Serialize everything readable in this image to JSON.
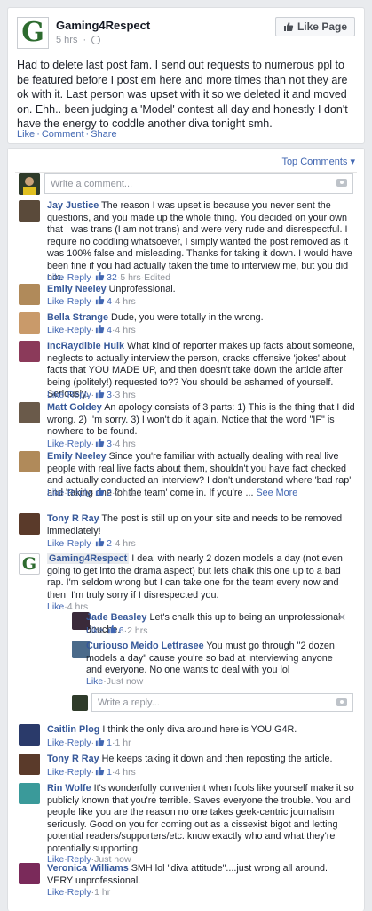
{
  "post": {
    "page_name": "Gaming4Respect",
    "logo_letter": "G",
    "time": "5 hrs",
    "like_page_label": "Like Page",
    "text": "Had to delete last post fam. I send out requests to numerous ppl to be featured before I post em here and more times than not they are ok with it. Last person was upset with it so we deleted it and moved on. Ehh.. been judging a 'Model' contest all day and honestly I don't have the energy to coddle another diva tonight smh.",
    "actions": [
      "Like",
      "Comment",
      "Share"
    ]
  },
  "comments_section": {
    "sort_label": "Top Comments ▾",
    "write_placeholder": "Write a comment...",
    "reply_placeholder": "Write a reply...",
    "comments": [
      {
        "name": "Jay Justice",
        "text": "The reason I was upset is because you never sent the questions, and you made up the whole thing. You decided on your own that I was trans (I am not trans) and were very rude and disrespectful. I require no coddling whatsoever, I simply wanted the post removed as it was 100% false and misleading. Thanks for taking it down. I would have been fine if you had actually taken the time to interview me, but you did not.",
        "likes": "32",
        "time": "5 hrs",
        "extra": "Edited",
        "avatar_color": "#5a4a3a"
      },
      {
        "name": "Emily Neeley",
        "text": "Unprofessional.",
        "likes": "4",
        "time": "4 hrs",
        "avatar_color": "#b08a5a"
      },
      {
        "name": "Bella Strange",
        "text": "Dude, you were totally in the wrong.",
        "likes": "4",
        "time": "4 hrs",
        "avatar_color": "#c99a6a"
      },
      {
        "name": "IncRaydible Hulk",
        "text": "What kind of reporter makes up facts about someone, neglects to actually interview the person, cracks offensive 'jokes' about facts that YOU MADE UP, and then doesn't take down the article after being (politely!) requested to?? You should be ashamed of yourself. Seriously.",
        "likes": "3",
        "time": "3 hrs",
        "avatar_color": "#8b3a5a"
      },
      {
        "name": "Matt Goldey",
        "text": "An apology consists of 3 parts: 1) This is the thing that I did wrong. 2) I'm sorry. 3) I won't do it again. Notice that the word \"IF\" is nowhere to be found.",
        "likes": "3",
        "time": "4 hrs",
        "avatar_color": "#6a5a4a"
      },
      {
        "name": "Emily Neeley",
        "text": "Since you're familiar with actually dealing with real live people with real live facts about them, shouldn't you have fact checked and actually conducted an interview? I don't understand where 'bad rap' and 'taking one for the team' come in. If you're ...",
        "see_more": "See More",
        "likes": "2",
        "time": "2 hrs",
        "avatar_color": "#b08a5a"
      },
      {
        "name": "Tony R Ray",
        "text": "The post is still up on your site and needs to be removed immediately!",
        "likes": "2",
        "time": "4 hrs",
        "avatar_color": "#5a3a2a"
      },
      {
        "name": "Gaming4Respect",
        "text": "I deal with nearly 2 dozen models a day (not even going to get into the drama aspect) but lets chalk this one up to a bad rap. I'm seldom wrong but I can take one for the team every now and then. I'm truly sorry if I disrespected you.",
        "time": "4 hrs",
        "avatar_color": "#2d6b2f"
      }
    ],
    "replies": [
      {
        "name": "Jade Beasley",
        "text": "Let's chalk this up to being an unprofessional douche.",
        "likes": "6",
        "time": "2 hrs",
        "avatar_color": "#3a2a3a"
      },
      {
        "name": "Curiouso Meido Lettrasee",
        "text": "You must go through \"2 dozen models a day\" cause you're so bad at interviewing anyone and everyone. No one wants to deal with you lol",
        "time": "Just now",
        "avatar_color": "#4a6a8a"
      }
    ],
    "later_comments": [
      {
        "name": "Caitlin Plog",
        "text": "I think the only diva around here is YOU G4R.",
        "likes": "1",
        "time": "1 hr",
        "avatar_color": "#2a3a6a"
      },
      {
        "name": "Tony R Ray",
        "text": "He keeps taking it down and then reposting the article.",
        "likes": "1",
        "time": "4 hrs",
        "avatar_color": "#5a3a2a"
      },
      {
        "name": "Rin Wolfe",
        "text": "It's wonderfully convenient when fools like yourself make it so publicly known that you're terrible. Saves everyone the trouble. You and people like you are the reason no one takes geek-centric journalism seriously. Good on you for coming out as a cissexist bigot and letting potential readers/supporters/etc. know exactly who and what they're potentially supporting.",
        "time": "Just now",
        "avatar_color": "#3a9a9a"
      },
      {
        "name": "Veronica Williams",
        "text": "SMH lol \"diva attitude\"....just wrong all around. VERY unprofessional.",
        "time": "1 hr",
        "avatar_color": "#7a2a5a"
      }
    ],
    "action_like": "Like",
    "action_reply": "Reply",
    "colors": {
      "link": "#4267b2",
      "name": "#365899",
      "muted": "#90949c",
      "background": "#e9ebee"
    }
  }
}
